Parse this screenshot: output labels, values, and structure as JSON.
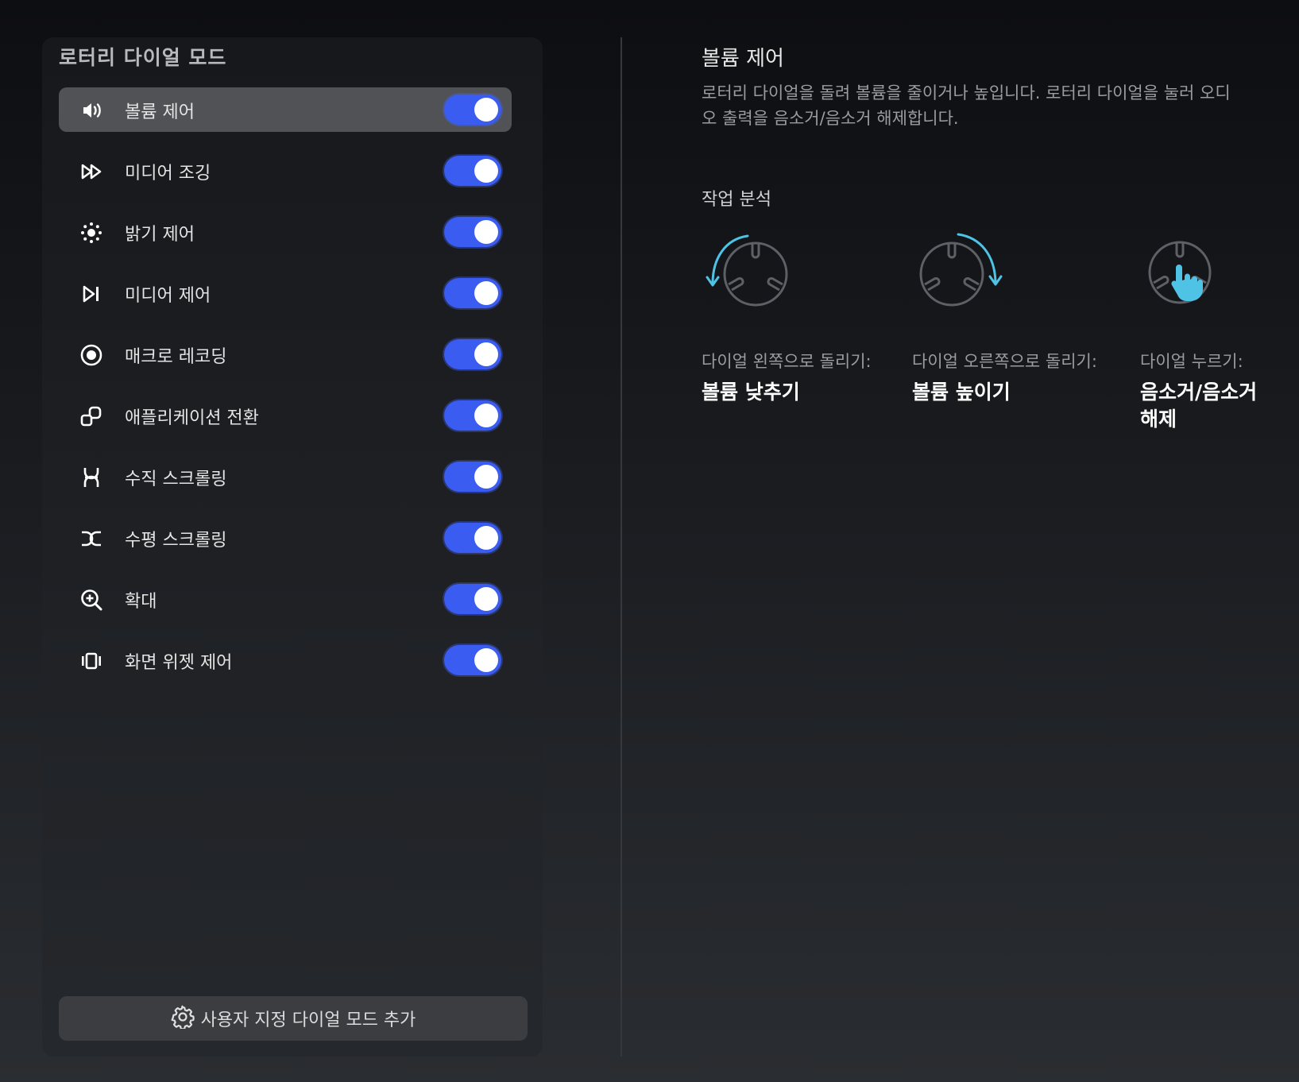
{
  "panel": {
    "title": "로터리 다이얼 모드",
    "modes": [
      {
        "label": "볼륨 제어",
        "icon": "volume-icon",
        "enabled": true,
        "selected": true
      },
      {
        "label": "미디어 조깅",
        "icon": "fast-forward-icon",
        "enabled": true,
        "selected": false
      },
      {
        "label": "밝기 제어",
        "icon": "brightness-icon",
        "enabled": true,
        "selected": false
      },
      {
        "label": "미디어 제어",
        "icon": "play-next-icon",
        "enabled": true,
        "selected": false
      },
      {
        "label": "매크로 레코딩",
        "icon": "record-icon",
        "enabled": true,
        "selected": false
      },
      {
        "label": "애플리케이션 전환",
        "icon": "app-switch-icon",
        "enabled": true,
        "selected": false
      },
      {
        "label": "수직 스크롤링",
        "icon": "vertical-scroll-icon",
        "enabled": true,
        "selected": false
      },
      {
        "label": "수평 스크롤링",
        "icon": "horizontal-scroll-icon",
        "enabled": true,
        "selected": false
      },
      {
        "label": "확대",
        "icon": "zoom-in-icon",
        "enabled": true,
        "selected": false
      },
      {
        "label": "화면 위젯 제어",
        "icon": "widget-carousel-icon",
        "enabled": true,
        "selected": false
      }
    ],
    "add_button_label": "사용자 지정 다이얼 모드 추가"
  },
  "detail": {
    "title": "볼륨 제어",
    "description": "로터리 다이얼을 돌려 볼륨을 줄이거나 높입니다. 로터리 다이얼을 눌러 오디오 출력을 음소거/음소거 해제합니다.",
    "section_label": "작업 분석",
    "actions": [
      {
        "caption": "다이얼 왼쪽으로 돌리기:",
        "value": "볼륨 낮추기",
        "icon": "dial-rotate-left-icon"
      },
      {
        "caption": "다이얼 오른쪽으로 돌리기:",
        "value": "볼륨 높이기",
        "icon": "dial-rotate-right-icon"
      },
      {
        "caption": "다이얼 누르기:",
        "value": "음소거/음소거 해제",
        "icon": "dial-press-icon"
      }
    ]
  },
  "colors": {
    "toggle_on": "#3a5cf0",
    "accent_cyan": "#4fc3e6",
    "selected_row": "#505256"
  }
}
